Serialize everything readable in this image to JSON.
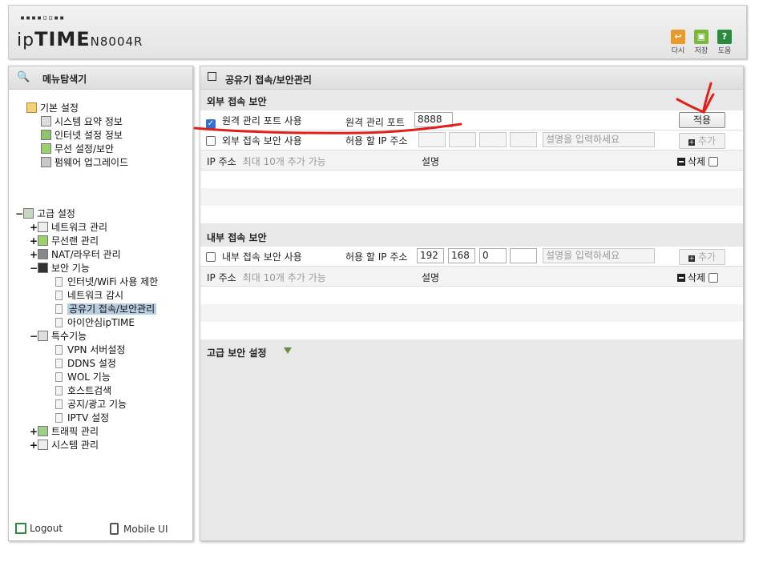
{
  "header": {
    "logo_dots": "▪▪▪▪▫▫▪▪",
    "logo_prefix": "ip",
    "logo_big": "TIME",
    "model": "N8004R",
    "buttons": [
      {
        "label": "다시",
        "icon": "undo-icon",
        "color": "#e89a2c"
      },
      {
        "label": "저장",
        "icon": "save-icon",
        "color": "#79b83a"
      },
      {
        "label": "도움",
        "icon": "help-icon",
        "color": "#2a8a3e"
      }
    ]
  },
  "sidebar": {
    "title": "메뉴탐색기",
    "basic": {
      "label": "기본 설정",
      "items": [
        "시스템 요약 정보",
        "인터넷 설정 정보",
        "무선 설정/보안",
        "펌웨어 업그레이드"
      ]
    },
    "advanced": {
      "label": "고급 설정",
      "items": [
        {
          "pm": "+",
          "label": "네트워크 관리"
        },
        {
          "pm": "+",
          "label": "무선랜 관리"
        },
        {
          "pm": "+",
          "label": "NAT/라우터 관리"
        },
        {
          "pm": "−",
          "label": "보안 기능"
        }
      ],
      "security_children": [
        "인터넷/WiFi 사용 제한",
        "네트워크 감시",
        "공유기 접속/보안관리",
        "아이안심ipTIME"
      ],
      "special": {
        "pm": "−",
        "label": "특수기능"
      },
      "special_children": [
        "VPN 서버설정",
        "DDNS 설정",
        "WOL 기능",
        "호스트검색",
        "공지/광고 기능",
        "IPTV 설정"
      ],
      "tail": [
        {
          "pm": "+",
          "label": "트래픽 관리"
        },
        {
          "pm": "+",
          "label": "시스템 관리"
        }
      ]
    },
    "footer": {
      "logout": "Logout",
      "mobile": "Mobile UI"
    }
  },
  "main": {
    "title": "공유기 접속/보안관리",
    "external": {
      "title": "외부 접속 보안",
      "remote_port_checkbox_label": "원격 관리 포트 사용",
      "remote_port_label": "원격 관리 포트",
      "remote_port_value": "8888",
      "apply_label": "적용",
      "ext_access_label": "외부 접속 보안 사용",
      "allow_ip_label": "허용 할 IP 주소",
      "ip_fields": [
        "",
        "",
        "",
        ""
      ],
      "desc_placeholder": "설명을 입력하세요",
      "add_label": "추가",
      "table_ip": "IP 주소",
      "table_hint": "최대 10개 추가 가능",
      "table_desc": "설명",
      "delete_label": "삭제"
    },
    "internal": {
      "title": "내부 접속 보안",
      "checkbox_label": "내부 접속 보안 사용",
      "allow_ip_label": "허용 할 IP 주소",
      "ip_fields": [
        "192",
        "168",
        "0",
        ""
      ],
      "desc_placeholder": "설명을 입력하세요",
      "add_label": "추가",
      "table_ip": "IP 주소",
      "table_hint": "최대 10개 추가 가능",
      "table_desc": "설명",
      "delete_label": "삭제"
    },
    "advanced_title": "고급 보안 설정"
  },
  "annotation": {
    "color": "#e0201a"
  }
}
